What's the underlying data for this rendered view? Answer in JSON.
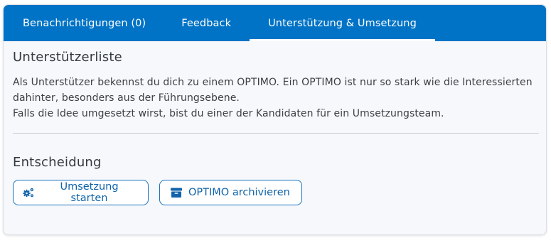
{
  "tabs": [
    {
      "label": "Benachrichtigungen (0)",
      "active": false
    },
    {
      "label": "Feedback",
      "active": false
    },
    {
      "label": "Unterstützung & Umsetzung",
      "active": true
    }
  ],
  "supporters": {
    "title": "Unterstützerliste",
    "text_line1": "Als Unterstützer bekennst du dich zu einem OPTIMO. Ein OPTIMO ist nur so stark wie die Interessierten",
    "text_line2": "dahinter, besonders aus der Führungsebene.",
    "text_line3": "Falls die Idee umgesetzt wirst, bist du einer der Kandidaten für ein Umsetzungsteam."
  },
  "decision": {
    "title": "Entscheidung",
    "start_button": {
      "label": "Umsetzung starten",
      "icon": "cogs-icon"
    },
    "archive_button": {
      "label": "OPTIMO archivieren",
      "icon": "archive-icon"
    }
  },
  "colors": {
    "tab_bar": "#0073c6",
    "button_text": "#0f63aa",
    "button_border": "#1a73c0",
    "card_background": "#f7f8fb"
  }
}
